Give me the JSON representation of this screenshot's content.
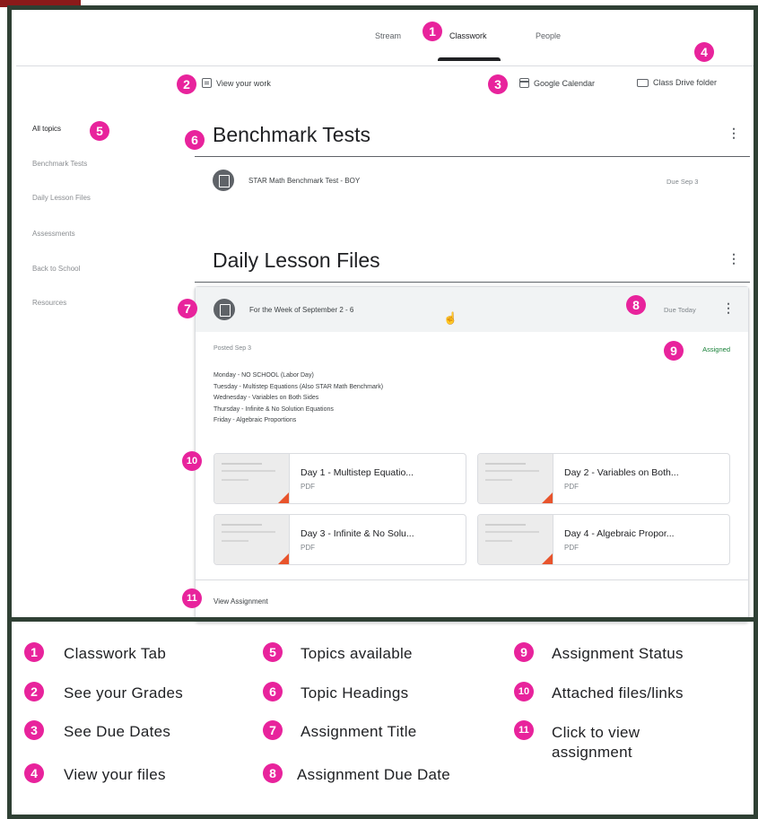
{
  "nav": {
    "tabs": [
      "Stream",
      "Classwork",
      "People"
    ],
    "active": "Classwork"
  },
  "actions": {
    "view_work": "View your work",
    "calendar": "Google Calendar",
    "drive": "Class Drive folder"
  },
  "sidebar": {
    "items": [
      "All topics",
      "Benchmark Tests",
      "Daily Lesson Files",
      "Assessments",
      "Back to School",
      "Resources"
    ]
  },
  "topics": [
    {
      "title": "Benchmark Tests",
      "assignments": [
        {
          "title": "STAR Math Benchmark Test - BOY",
          "due": "Due Sep 3"
        }
      ]
    },
    {
      "title": "Daily Lesson Files",
      "assignment": {
        "title": "For the Week of September 2 - 6",
        "due": "Due Today",
        "posted": "Posted Sep 3",
        "status": "Assigned",
        "description": [
          "Monday - NO SCHOOL (Labor Day)",
          "Tuesday - Multistep Equations (Also STAR Math Benchmark)",
          "Wednesday - Variables on Both Sides",
          "Thursday - Infinite & No Solution Equations",
          "Friday - Algebraic Proportions"
        ],
        "attachments": [
          {
            "title": "Day 1 - Multistep Equatio...",
            "type": "PDF"
          },
          {
            "title": "Day 2 - Variables on Both...",
            "type": "PDF"
          },
          {
            "title": "Day 3 - Infinite & No Solu...",
            "type": "PDF"
          },
          {
            "title": "Day 4 - Algebraic Propor...",
            "type": "PDF"
          }
        ],
        "view_label": "View Assignment"
      }
    }
  ],
  "badges": [
    "1",
    "2",
    "3",
    "4",
    "5",
    "6",
    "7",
    "8",
    "9",
    "10",
    "11"
  ],
  "legend": [
    {
      "num": "1",
      "label": "Classwork Tab"
    },
    {
      "num": "2",
      "label": "See your Grades"
    },
    {
      "num": "3",
      "label": "See Due Dates"
    },
    {
      "num": "4",
      "label": "View your files"
    },
    {
      "num": "5",
      "label": "Topics available"
    },
    {
      "num": "6",
      "label": "Topic Headings"
    },
    {
      "num": "7",
      "label": "Assignment Title"
    },
    {
      "num": "8",
      "label": "Assignment Due Date"
    },
    {
      "num": "9",
      "label": "Assignment Status"
    },
    {
      "num": "10",
      "label": "Attached files/links"
    },
    {
      "num": "11",
      "label": "Click to view assignment"
    }
  ],
  "colors": {
    "badge": "#e8239c",
    "status": "#188038",
    "frame": "#2f4034",
    "attachment_corner": "#e8542c"
  }
}
